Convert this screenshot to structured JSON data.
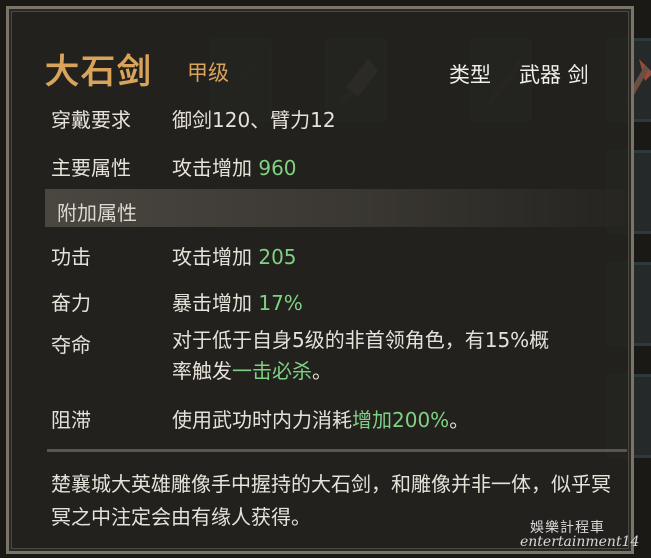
{
  "item": {
    "name": "大石剑",
    "grade": "甲级",
    "type_label": "类型",
    "type_value": "武器 剑"
  },
  "requirements": {
    "label": "穿戴要求",
    "value": "御剑120、臂力12"
  },
  "main_attr": {
    "label": "主要属性",
    "text": "攻击增加 ",
    "num": "960"
  },
  "bonus_section": {
    "title": "附加属性"
  },
  "bonuses": [
    {
      "label": "功击",
      "text": "攻击增加 ",
      "num": "205"
    },
    {
      "label": "奋力",
      "text": "暴击增加 ",
      "num": "17%"
    }
  ],
  "skill_ming": {
    "label": "夺命",
    "line1": "对于低于自身5级的非首领角色，有15%概",
    "line2_prefix": "率触发",
    "line2_green": "一击必杀",
    "line2_suffix": "。"
  },
  "skill_zhi": {
    "label": "阻滞",
    "prefix": "使用武功时内力消耗",
    "green": "增加200%",
    "suffix": "。"
  },
  "lore": "楚襄城大英雄雕像手中握持的大石剑，和雕像并非一体，似乎冥冥之中注定会由有缘人获得。",
  "watermark": {
    "line1": "娛樂計程車",
    "line2": "entertainment14"
  },
  "colors": {
    "title": "#d9a35a",
    "value_green": "#7fd183",
    "frame": "#7b7468"
  },
  "background_slot_icons": [
    "sword-icon",
    "cleaver-icon",
    "staff-icon",
    "axe-icon"
  ]
}
